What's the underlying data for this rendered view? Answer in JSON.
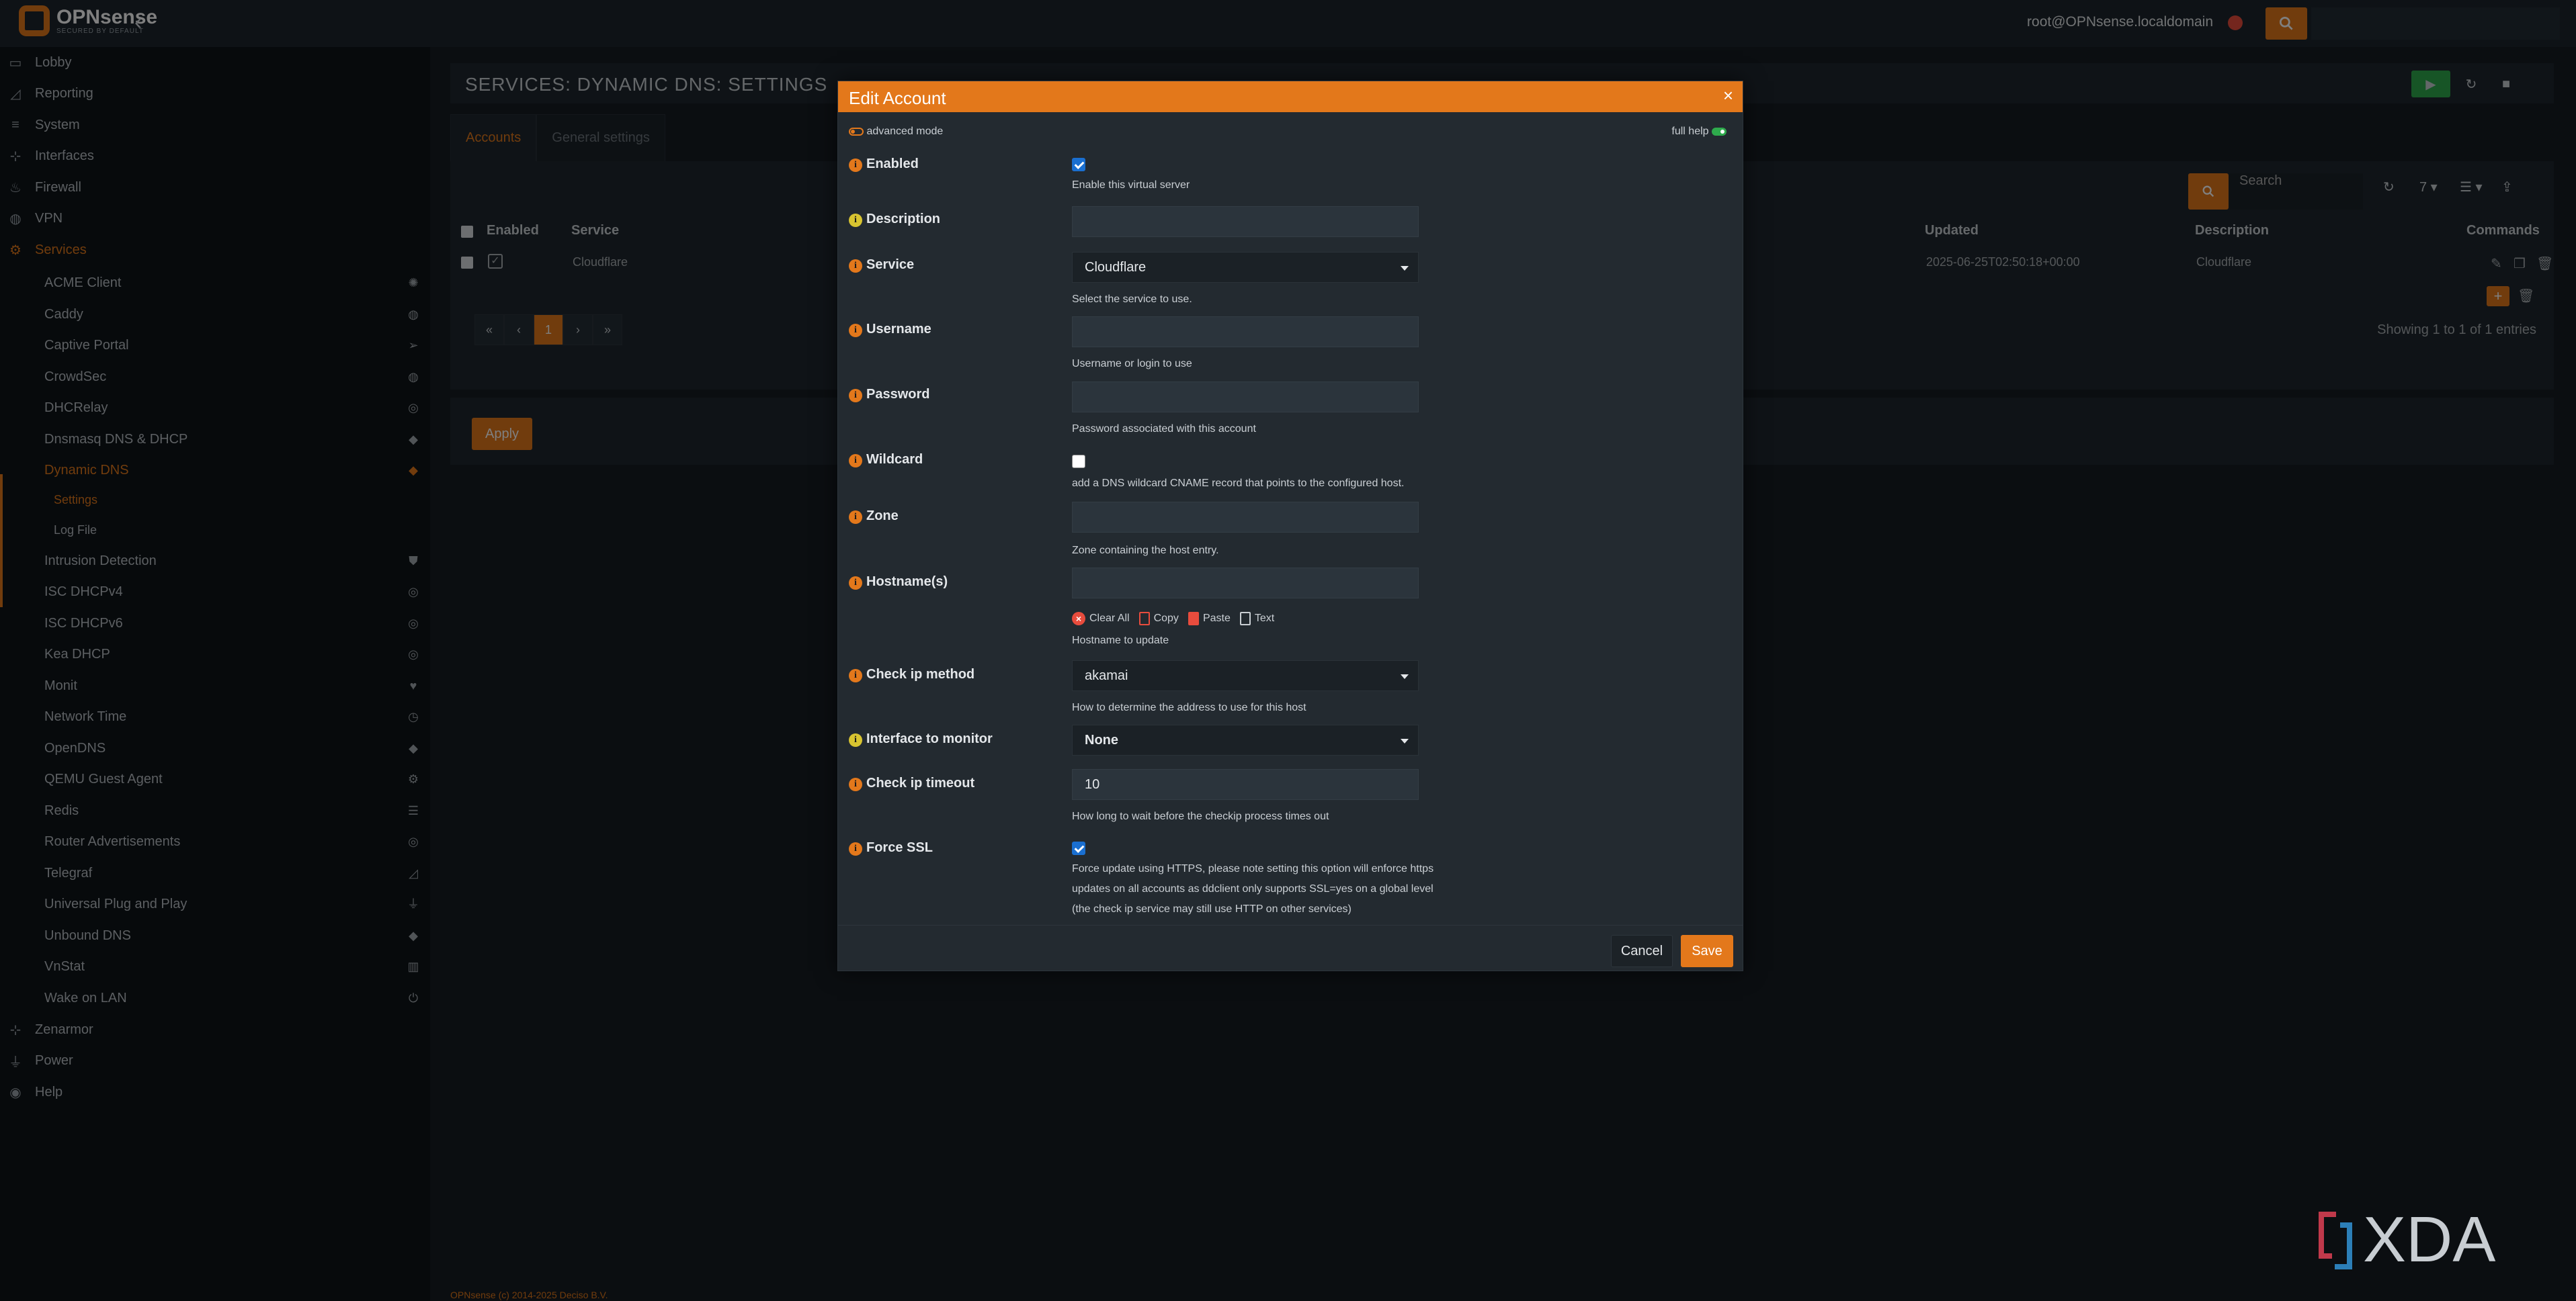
{
  "topbar": {
    "brand": "OPNsense",
    "brand_sub": "SECURED BY DEFAULT",
    "user": "root@OPNsense.localdomain"
  },
  "sidebar": {
    "top_items": [
      {
        "label": "Lobby",
        "icon": "laptop-icon"
      },
      {
        "label": "Reporting",
        "icon": "area-chart-icon"
      },
      {
        "label": "System",
        "icon": "server-icon"
      },
      {
        "label": "Interfaces",
        "icon": "sitemap-icon"
      },
      {
        "label": "Firewall",
        "icon": "fire-icon"
      },
      {
        "label": "VPN",
        "icon": "globe-icon"
      },
      {
        "label": "Services",
        "icon": "cog-icon"
      }
    ],
    "services": [
      {
        "label": "ACME Client",
        "icon": "certificate-icon"
      },
      {
        "label": "Caddy",
        "icon": "globe-icon"
      },
      {
        "label": "Captive Portal",
        "icon": "paper-plane-icon"
      },
      {
        "label": "CrowdSec",
        "icon": "globe-icon"
      },
      {
        "label": "DHCRelay",
        "icon": "bullseye-icon"
      },
      {
        "label": "Dnsmasq DNS & DHCP",
        "icon": "tags-icon"
      },
      {
        "label": "Dynamic DNS",
        "icon": "tags-icon"
      },
      {
        "label": "Intrusion Detection",
        "icon": "shield-icon"
      },
      {
        "label": "ISC DHCPv4",
        "icon": "bullseye-icon"
      },
      {
        "label": "ISC DHCPv6",
        "icon": "bullseye-icon"
      },
      {
        "label": "Kea DHCP",
        "icon": "bullseye-icon"
      },
      {
        "label": "Monit",
        "icon": "heartbeat-icon"
      },
      {
        "label": "Network Time",
        "icon": "clock-icon"
      },
      {
        "label": "OpenDNS",
        "icon": "tags-icon"
      },
      {
        "label": "QEMU Guest Agent",
        "icon": "cog-icon"
      },
      {
        "label": "Redis",
        "icon": "database-icon"
      },
      {
        "label": "Router Advertisements",
        "icon": "bullseye-icon"
      },
      {
        "label": "Telegraf",
        "icon": "area-chart-icon"
      },
      {
        "label": "Universal Plug and Play",
        "icon": "plug-icon"
      },
      {
        "label": "Unbound DNS",
        "icon": "tags-icon"
      },
      {
        "label": "VnStat",
        "icon": "bar-chart-icon"
      },
      {
        "label": "Wake on LAN",
        "icon": "power-icon"
      }
    ],
    "dyndns_sub": [
      "Settings",
      "Log File"
    ],
    "bottom_items": [
      {
        "label": "Zenarmor",
        "icon": "sitemap-icon"
      },
      {
        "label": "Power",
        "icon": "plug-icon"
      },
      {
        "label": "Help",
        "icon": "help-icon"
      }
    ]
  },
  "main": {
    "page_title": "SERVICES: DYNAMIC DNS: SETTINGS",
    "tabs": [
      "Accounts",
      "General settings"
    ],
    "grid": {
      "search_placeholder": "Search",
      "page_size": "7",
      "columns": [
        "Enabled",
        "Service",
        "Updated",
        "Description",
        "Commands"
      ],
      "rows": [
        {
          "service": "Cloudflare",
          "updated": "2025-06-25T02:50:18+00:00",
          "description": "Cloudflare"
        }
      ],
      "pager": [
        "«",
        "‹",
        "1",
        "›",
        "»"
      ],
      "showing": "Showing 1 to 1 of 1 entries"
    },
    "apply": "Apply",
    "footer": "OPNsense (c) 2014-2025 Deciso B.V."
  },
  "modal": {
    "title": "Edit Account",
    "advanced_mode": "advanced mode",
    "full_help": "full help",
    "fields": {
      "enabled": {
        "label": "Enabled",
        "help": "Enable this virtual server"
      },
      "description": {
        "label": "Description"
      },
      "service": {
        "label": "Service",
        "value": "Cloudflare",
        "help": "Select the service to use."
      },
      "username": {
        "label": "Username",
        "help": "Username or login to use"
      },
      "password": {
        "label": "Password",
        "help": "Password associated with this account"
      },
      "wildcard": {
        "label": "Wildcard",
        "help": "add a DNS wildcard CNAME record that points to the configured host."
      },
      "zone": {
        "label": "Zone",
        "help": "Zone containing the host entry."
      },
      "hostnames": {
        "label": "Hostname(s)",
        "help": "Hostname to update"
      },
      "checkip": {
        "label": "Check ip method",
        "value": "akamai",
        "help": "How to determine the address to use for this host"
      },
      "interface": {
        "label": "Interface to monitor",
        "value": "None"
      },
      "timeout": {
        "label": "Check ip timeout",
        "value": "10",
        "help": "How long to wait before the checkip process times out"
      },
      "force_ssl": {
        "label": "Force SSL",
        "help": "Force update using HTTPS, please note setting this option will enforce https updates on all accounts as ddclient only supports SSL=yes on a global level (the check ip service may still use HTTP on other services)"
      }
    },
    "tag_tools": [
      "Clear All",
      "Copy",
      "Paste",
      "Text"
    ],
    "cancel": "Cancel",
    "save": "Save"
  },
  "watermark": "XDA",
  "colors": {
    "accent": "#e3781b",
    "background": "#171d22",
    "sidebar": "#0f1418"
  }
}
